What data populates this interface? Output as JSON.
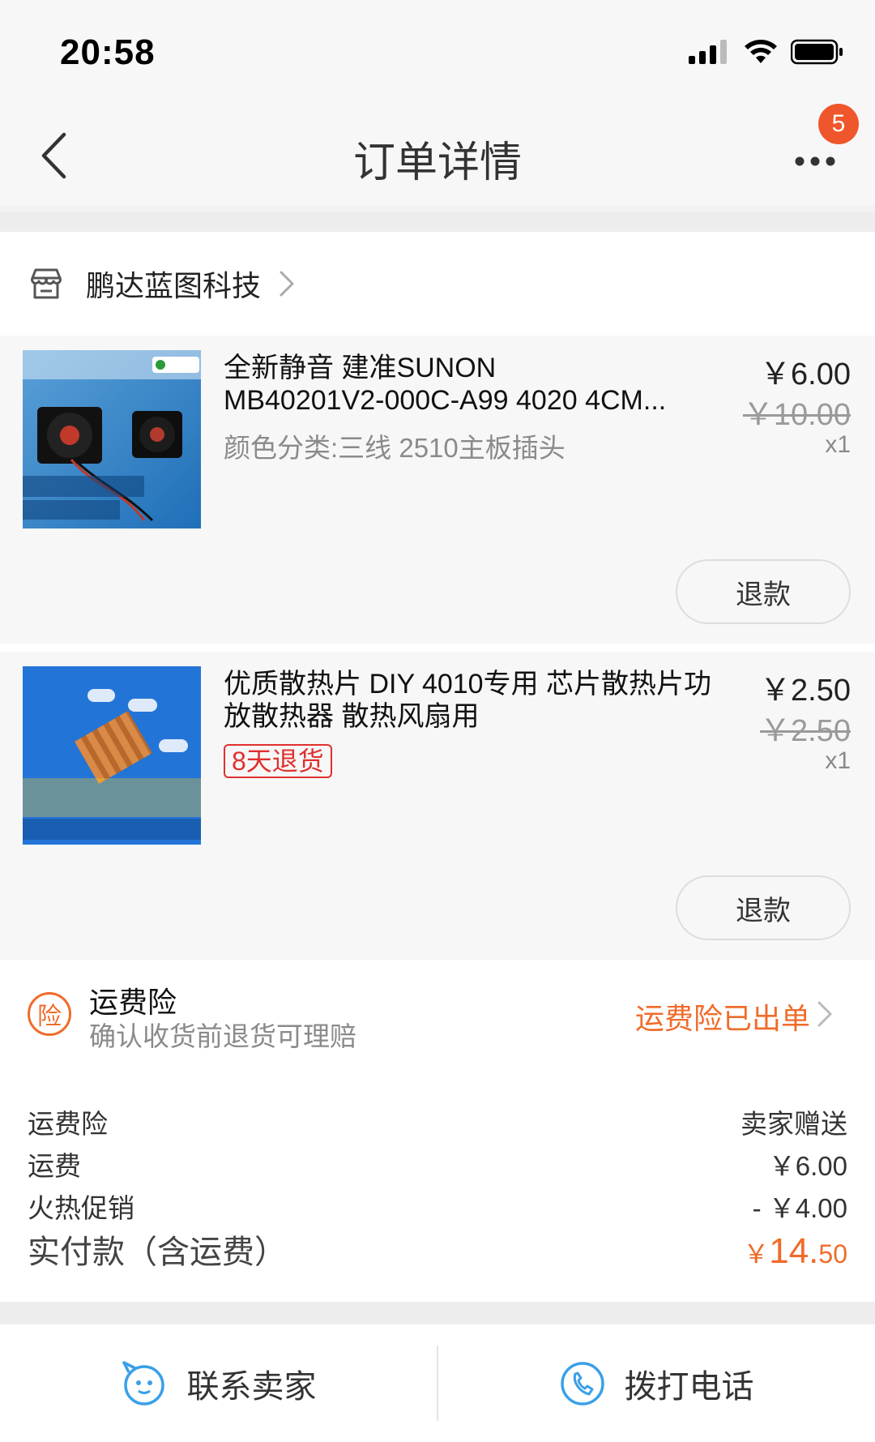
{
  "status_bar": {
    "time": "20:58"
  },
  "nav": {
    "title": "订单详情",
    "badge_count": "5"
  },
  "shop": {
    "name": "鹏达蓝图科技"
  },
  "items": [
    {
      "title_line1": "全新静音 建准SUNON",
      "title_line2": "MB40201V2-000C-A99 4020 4CM...",
      "spec": "颜色分类:三线 2510主板插头",
      "price": "￥6.00",
      "orig_price": "￥10.00",
      "qty": "x1",
      "refund_label": "退款"
    },
    {
      "title_line1": "优质散热片 DIY 4010专用 芯片散热片功",
      "title_line2": "放散热器 散热风扇用",
      "tag": "8天退货",
      "price": "￥2.50",
      "orig_price": "￥2.50",
      "qty": "x1",
      "refund_label": "退款"
    }
  ],
  "insurance": {
    "icon_char": "险",
    "title": "运费险",
    "subtitle": "确认收货前退货可理赔",
    "status": "运费险已出单"
  },
  "summary": {
    "rows": [
      {
        "label": "运费险",
        "value": "卖家赠送"
      },
      {
        "label": "运费",
        "value": "￥6.00"
      },
      {
        "label": "火热促销",
        "value": "- ￥4.00"
      }
    ],
    "total_label": "实付款（含运费）",
    "total_currency": "￥",
    "total_int": "14.",
    "total_dec": "50"
  },
  "bottom": {
    "contact_seller": "联系卖家",
    "call_phone": "拨打电话"
  },
  "colors": {
    "accent": "#f06b2a",
    "badge": "#f0562b",
    "tag": "#e0302e",
    "icon_blue": "#3aa0e8"
  }
}
